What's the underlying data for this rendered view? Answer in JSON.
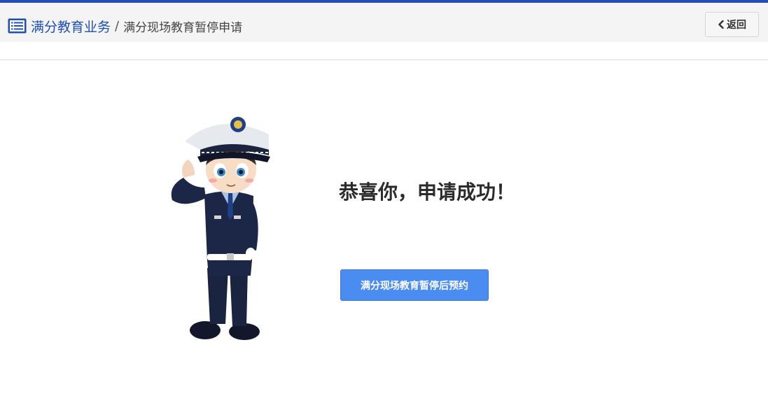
{
  "header": {
    "breadcrumb_root": "满分教育业务",
    "breadcrumb_separator": "/",
    "breadcrumb_current": "满分现场教育暂停申请",
    "back_label": "返回",
    "accent_color": "#1f4fb5"
  },
  "icons": {
    "menu": "list-icon",
    "back": "chevron-left-icon",
    "illustration": "police-officer-saluting"
  },
  "main": {
    "success_message": "恭喜你，申请成功！",
    "action_button_label": "满分现场教育暂停后预约",
    "button_color": "#4a8cf0"
  }
}
